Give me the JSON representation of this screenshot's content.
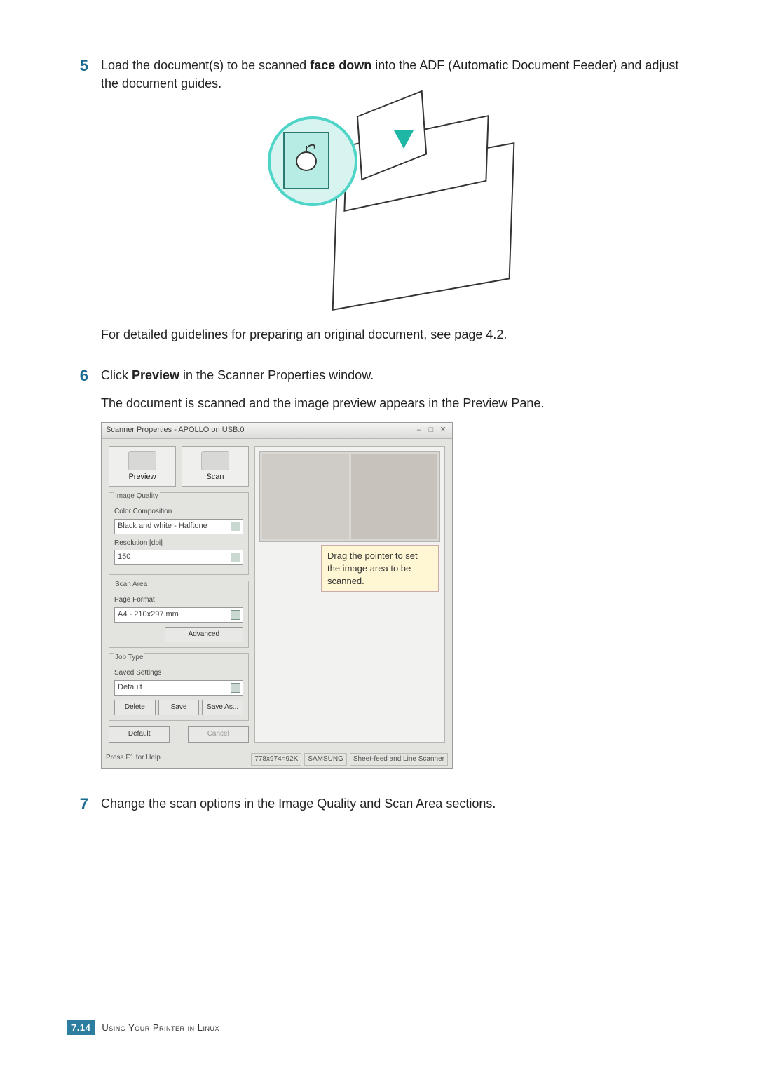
{
  "steps": {
    "s5": {
      "num": "5",
      "p1_a": "Load the document(s) to be scanned ",
      "p1_bold": "face down",
      "p1_b": " into the ADF (Automatic Document Feeder) and adjust the document guides.",
      "p2": "For detailed guidelines for preparing an original document, see page 4.2."
    },
    "s6": {
      "num": "6",
      "p1_a": "Click ",
      "p1_bold": "Preview",
      "p1_b": " in the Scanner Properties window.",
      "p2": "The document is scanned and the image preview appears in the Preview Pane."
    },
    "s7": {
      "num": "7",
      "p1": "Change the scan options in the Image Quality and Scan Area sections."
    }
  },
  "scanner": {
    "title": "Scanner Properties - APOLLO on USB:0",
    "preview_btn": "Preview",
    "scan_btn": "Scan",
    "grp_image": "Image Quality",
    "lbl_color": "Color Composition",
    "val_color": "Black and white - Halftone",
    "lbl_res": "Resolution [dpi]",
    "val_res": "150",
    "grp_area": "Scan Area",
    "lbl_page": "Page Format",
    "val_page": "A4 - 210x297 mm",
    "btn_adv": "Advanced",
    "grp_job": "Job Type",
    "lbl_saved": "Saved Settings",
    "val_saved": "Default",
    "btn_delete": "Delete",
    "btn_save": "Save",
    "btn_saveas": "Save As...",
    "btn_default": "Default",
    "btn_cancel": "Cancel",
    "callout": "Drag the pointer to set the image area to be scanned.",
    "status_help": "Press F1 for Help",
    "status_size": "778x974=92K",
    "status_vendor": "SAMSUNG",
    "status_type": "Sheet-feed and Line Scanner"
  },
  "footer": {
    "pagenum": "7.14",
    "section": "Using Your Printer in Linux"
  }
}
